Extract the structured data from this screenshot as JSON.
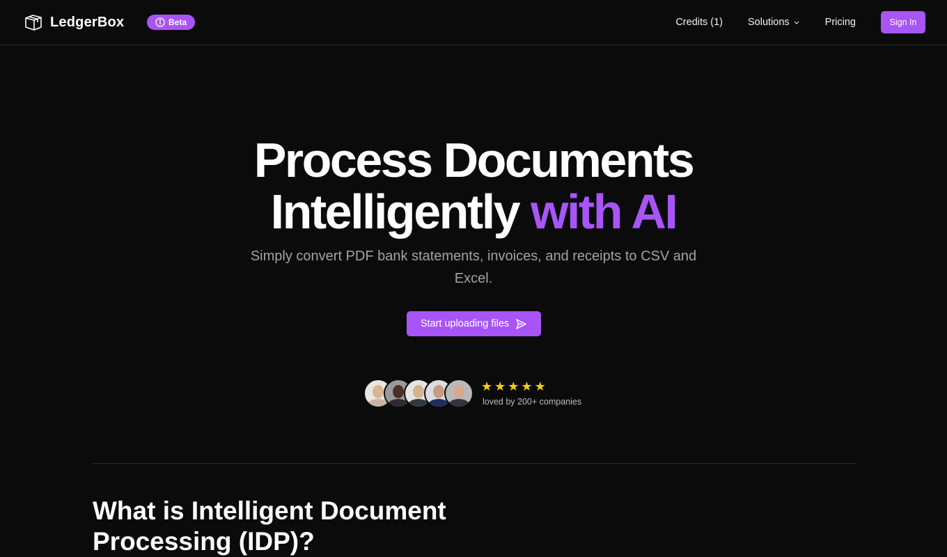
{
  "header": {
    "brand": "LedgerBox",
    "beta_label": "Beta",
    "nav": [
      {
        "label": "Credits (1)",
        "icon": null
      },
      {
        "label": "Solutions",
        "icon": "chevron-down-icon"
      },
      {
        "label": "Pricing",
        "icon": null
      }
    ],
    "sign_in_label": "Sign In"
  },
  "hero": {
    "title_line1": "Process Documents",
    "title_line2_plain": "Intelligently",
    "title_line2_accent": "with AI",
    "subtitle": "Simply convert PDF bank statements, invoices, and receipts to CSV and Excel.",
    "cta_label": "Start uploading files",
    "cta_icon": "send-icon"
  },
  "social_proof": {
    "rating_stars": 5,
    "rating_max": 5,
    "caption": "loved by 200+ companies",
    "avatar_count": 5
  },
  "section": {
    "title": "What is Intelligent Document Processing (IDP)?"
  },
  "colors": {
    "accent": "#a855f7",
    "background": "#0b0b0c",
    "star": "#facc15"
  }
}
